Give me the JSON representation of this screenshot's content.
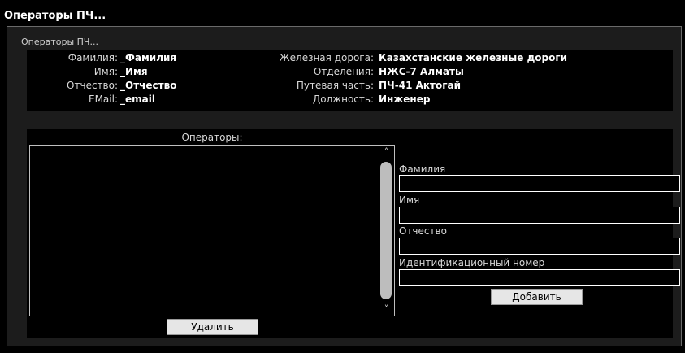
{
  "page": {
    "title": "Операторы ПЧ..."
  },
  "info": {
    "caption": "Операторы ПЧ...",
    "left": [
      {
        "label": "Фамилия:",
        "value": "_Фамилия"
      },
      {
        "label": "Имя:",
        "value": "_Имя"
      },
      {
        "label": "Отчество:",
        "value": "_Отчество"
      },
      {
        "label": "EMail:",
        "value": "_email"
      }
    ],
    "right": [
      {
        "label": "Железная дорога:",
        "value": "Казахстанские железные дороги"
      },
      {
        "label": "Отделения:",
        "value": "НЖС-7 Алматы"
      },
      {
        "label": "Путевая часть:",
        "value": "ПЧ-41 Актогай"
      },
      {
        "label": "Должность:",
        "value": "Инженер"
      }
    ]
  },
  "operators": {
    "caption": "Операторы:",
    "items": [],
    "delete_label": "Удалить",
    "scroll_up_icon": "chevron-up-icon",
    "scroll_down_icon": "chevron-down-icon"
  },
  "form": {
    "last_name_label": "Фамилия",
    "last_name_value": "",
    "first_name_label": "Имя",
    "first_name_value": "",
    "patronymic_label": "Отчество",
    "patronymic_value": "",
    "id_number_label": "Идентификационный номер",
    "id_number_value": "",
    "add_label": "Добавить"
  },
  "colors": {
    "background": "#000000",
    "panel": "#1c1c1c",
    "divider": "#8a9a2a",
    "button": "#e6e6e6"
  }
}
